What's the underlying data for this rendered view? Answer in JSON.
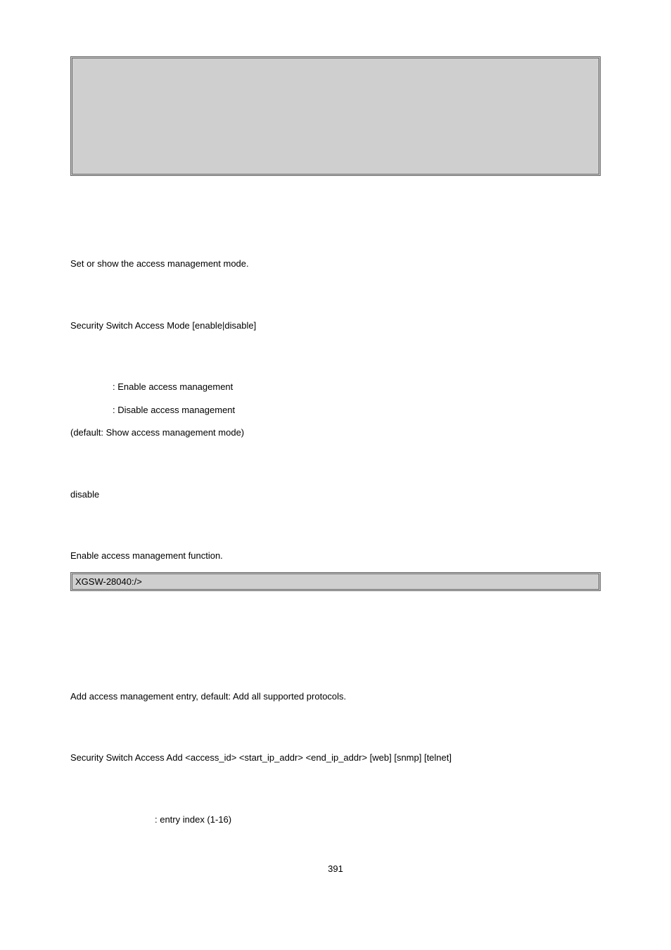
{
  "section1": {
    "desc": "Set or show the access management mode.",
    "syntax": "Security Switch Access Mode [enable|disable]",
    "param1": ": Enable access management",
    "param2": ": Disable access management",
    "paramDefault": "(default: Show access management mode)",
    "defaultVal": "disable",
    "exampleDesc": "Enable access management function.",
    "examplePrompt": "XGSW-28040:/>"
  },
  "section2": {
    "desc": "Add access management entry, default: Add all supported protocols.",
    "syntax": "Security Switch Access Add <access_id> <start_ip_addr> <end_ip_addr> [web] [snmp] [telnet]",
    "param1": ": entry index (1-16)"
  },
  "pageNumber": "391"
}
